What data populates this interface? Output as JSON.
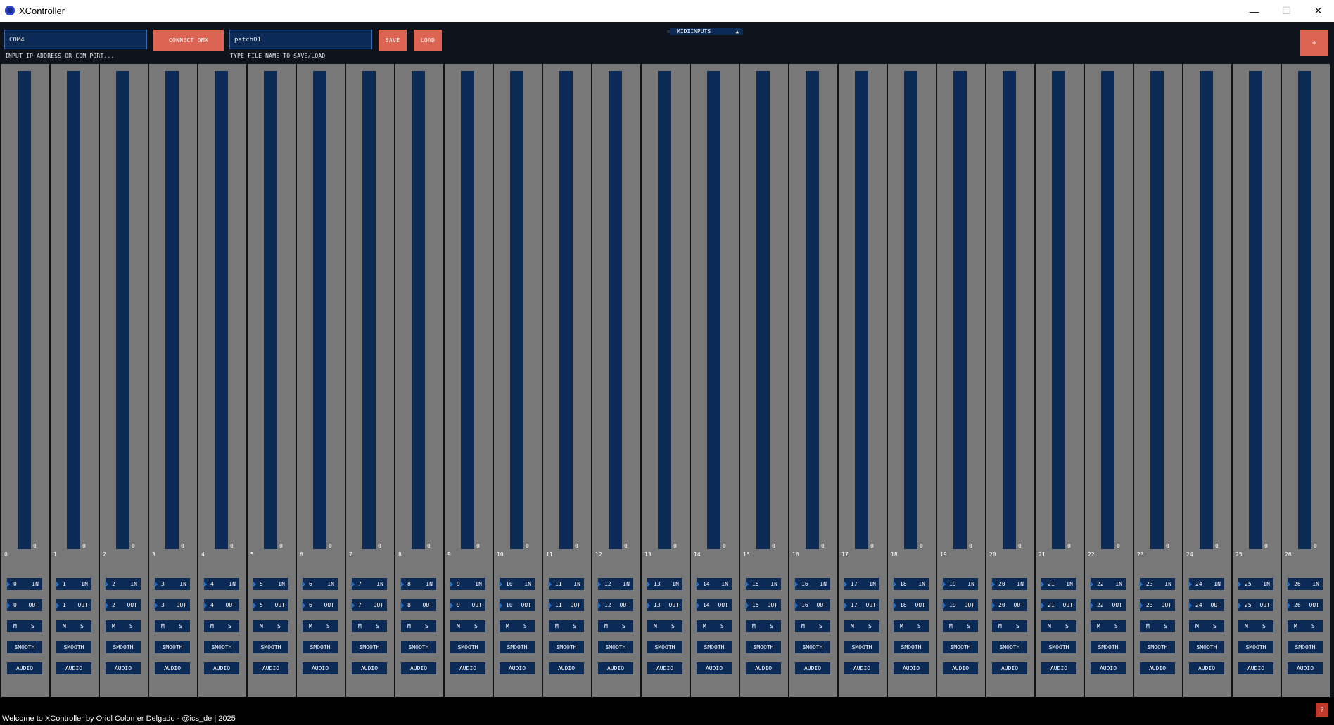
{
  "window": {
    "title": "XController",
    "minimize": "—",
    "maximize": "☐",
    "close": "✕"
  },
  "topbar": {
    "ip_input": {
      "value": "COM4",
      "hint": "INPUT IP ADDRESS OR COM PORT..."
    },
    "connect_label": "CONNECT DMX",
    "file_input": {
      "value": "patch01",
      "hint": "TYPE FILE NAME TO SAVE/LOAD"
    },
    "save_label": "SAVE",
    "load_label": "LOAD",
    "midi_dropdown": {
      "label": "MIDIINPUTS",
      "arrow": "▲"
    },
    "add_label": "+"
  },
  "channels": [
    {
      "num": "0",
      "value": "0",
      "in": "0",
      "out": "0"
    },
    {
      "num": "1",
      "value": "0",
      "in": "1",
      "out": "1"
    },
    {
      "num": "2",
      "value": "0",
      "in": "2",
      "out": "2"
    },
    {
      "num": "3",
      "value": "0",
      "in": "3",
      "out": "3"
    },
    {
      "num": "4",
      "value": "0",
      "in": "4",
      "out": "4"
    },
    {
      "num": "5",
      "value": "0",
      "in": "5",
      "out": "5"
    },
    {
      "num": "6",
      "value": "0",
      "in": "6",
      "out": "6"
    },
    {
      "num": "7",
      "value": "0",
      "in": "7",
      "out": "7"
    },
    {
      "num": "8",
      "value": "0",
      "in": "8",
      "out": "8"
    },
    {
      "num": "9",
      "value": "0",
      "in": "9",
      "out": "9"
    },
    {
      "num": "10",
      "value": "0",
      "in": "10",
      "out": "10"
    },
    {
      "num": "11",
      "value": "0",
      "in": "11",
      "out": "11"
    },
    {
      "num": "12",
      "value": "0",
      "in": "12",
      "out": "12"
    },
    {
      "num": "13",
      "value": "0",
      "in": "13",
      "out": "13"
    },
    {
      "num": "14",
      "value": "0",
      "in": "14",
      "out": "14"
    },
    {
      "num": "15",
      "value": "0",
      "in": "15",
      "out": "15"
    },
    {
      "num": "16",
      "value": "0",
      "in": "16",
      "out": "16"
    },
    {
      "num": "17",
      "value": "0",
      "in": "17",
      "out": "17"
    },
    {
      "num": "18",
      "value": "0",
      "in": "18",
      "out": "18"
    },
    {
      "num": "19",
      "value": "0",
      "in": "19",
      "out": "19"
    },
    {
      "num": "20",
      "value": "0",
      "in": "20",
      "out": "20"
    },
    {
      "num": "21",
      "value": "0",
      "in": "21",
      "out": "21"
    },
    {
      "num": "22",
      "value": "0",
      "in": "22",
      "out": "22"
    },
    {
      "num": "23",
      "value": "0",
      "in": "23",
      "out": "23"
    },
    {
      "num": "24",
      "value": "0",
      "in": "24",
      "out": "24"
    },
    {
      "num": "25",
      "value": "0",
      "in": "25",
      "out": "25"
    },
    {
      "num": "26",
      "value": "0",
      "in": "26",
      "out": "26"
    }
  ],
  "strip_labels": {
    "in_tag": "IN",
    "out_tag": "OUT",
    "mute": "M",
    "solo": "S",
    "smooth": "SMOOTH",
    "audio": "AUDIO"
  },
  "status": {
    "text": "Welcome to XController by Oriol Colomer Delgado - @ics_de | 2025",
    "help_label": "?"
  },
  "colors": {
    "accent": "#db6552",
    "panel_blue": "#0b2a55",
    "strip_gray": "#787878",
    "background": "#101316"
  }
}
